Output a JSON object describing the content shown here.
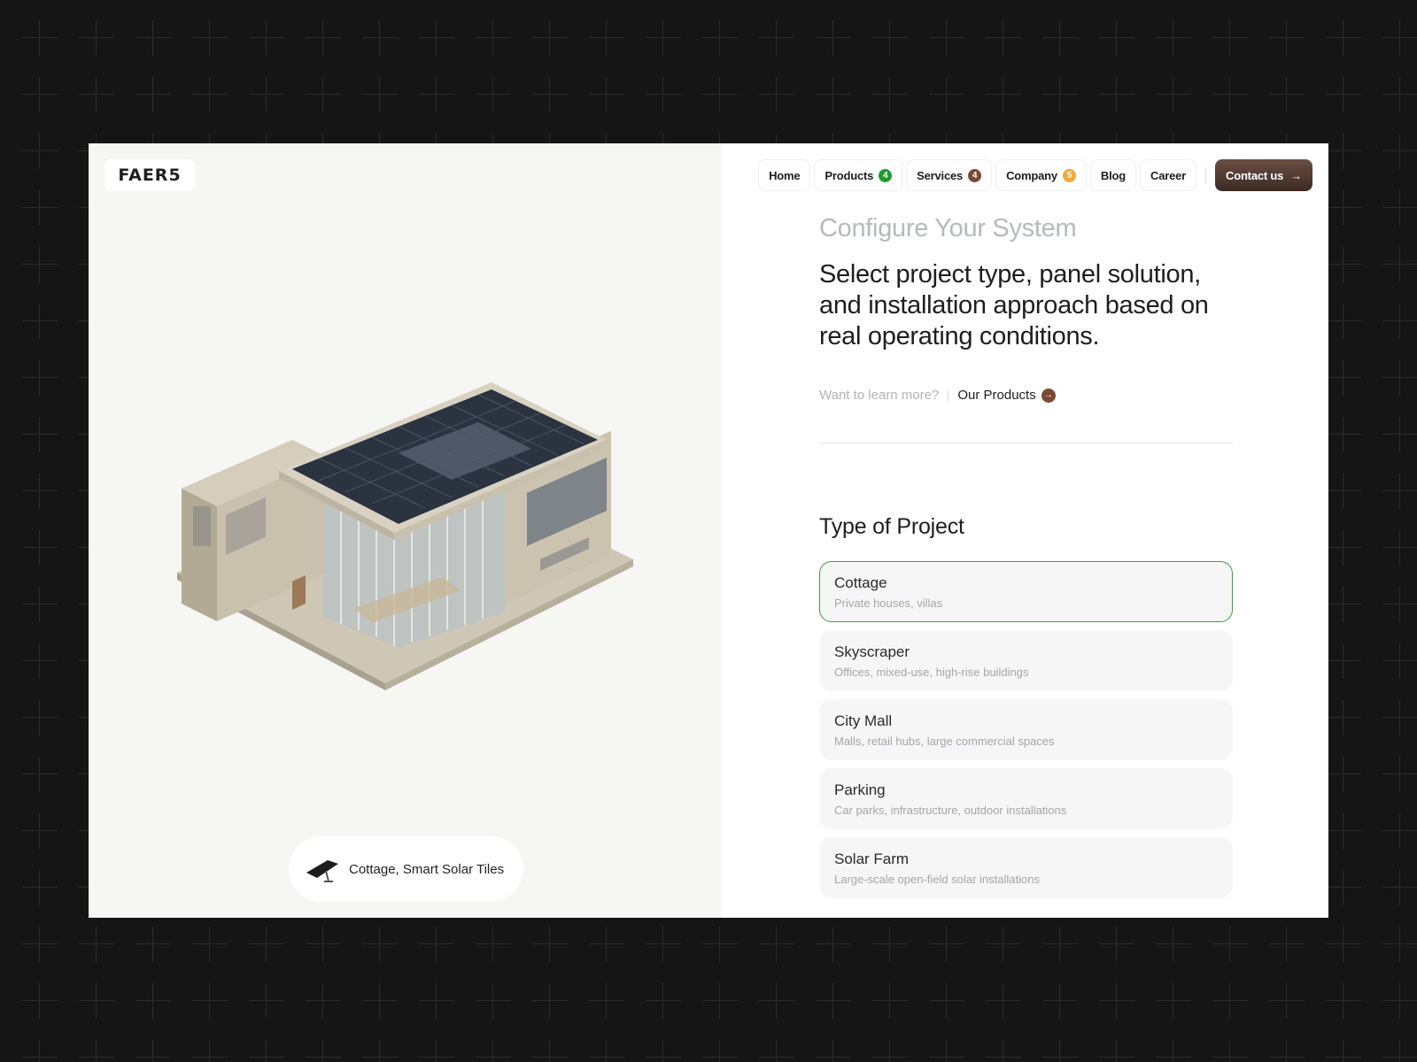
{
  "brand": {
    "logo_text": "FAER5"
  },
  "nav": {
    "items": [
      {
        "label": "Home"
      },
      {
        "label": "Products",
        "badge": "4",
        "badge_color": "#1f9b2e"
      },
      {
        "label": "Services",
        "badge": "4",
        "badge_color": "#7a4a36"
      },
      {
        "label": "Company",
        "badge": "5",
        "badge_color": "#f0a93a"
      },
      {
        "label": "Blog"
      },
      {
        "label": "Career"
      }
    ],
    "contact_label": "Contact us",
    "contact_arrow": "→"
  },
  "hero": {
    "caption": "Cottage, Smart Solar Tiles"
  },
  "config": {
    "eyebrow": "Configure Your System",
    "headline": "Select project type, panel solution, and installation approach based on real operating conditions.",
    "learn_question": "Want to learn more?",
    "learn_link": "Our Products",
    "learn_arrow": "→"
  },
  "project": {
    "title": "Type of Project",
    "options": [
      {
        "title": "Cottage",
        "desc": "Private houses, villas",
        "selected": true
      },
      {
        "title": "Skyscraper",
        "desc": "Offices, mixed-use, high-rise buildings",
        "selected": false
      },
      {
        "title": "City Mall",
        "desc": "Malls, retail hubs, large commercial spaces",
        "selected": false
      },
      {
        "title": "Parking",
        "desc": "Car parks, infrastructure, outdoor installations",
        "selected": false
      },
      {
        "title": "Solar Farm",
        "desc": "Large-scale open-field solar installations",
        "selected": false
      }
    ]
  },
  "colors": {
    "accent_selected": "#3aa142",
    "contact_bg": "#4a352e",
    "background": "#151515"
  }
}
